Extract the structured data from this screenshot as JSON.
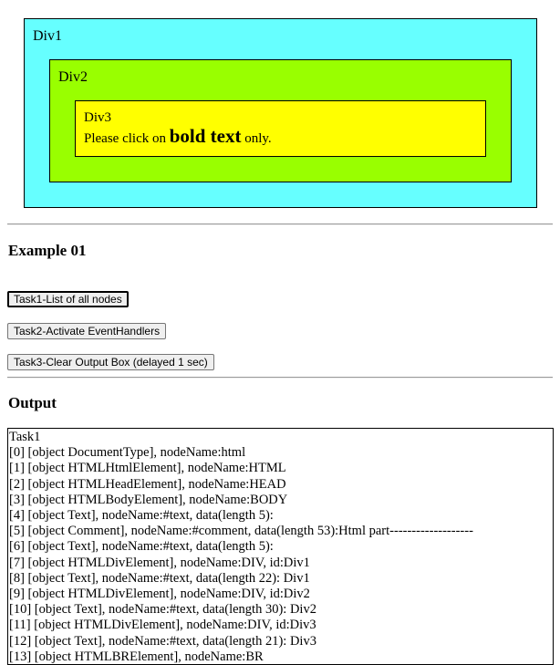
{
  "div1": {
    "label": "Div1"
  },
  "div2": {
    "label": "Div2"
  },
  "div3": {
    "label": "Div3",
    "text_before": "Please click on ",
    "bold_text": "bold text",
    "text_after": " only."
  },
  "example": {
    "heading": "Example 01"
  },
  "buttons": {
    "task1": "Task1-List of all nodes",
    "task2": "Task2-Activate EventHandlers",
    "task3": "Task3-Clear Output Box (delayed 1 sec)"
  },
  "output": {
    "heading": "Output",
    "lines": [
      "Task1",
      "[0] [object DocumentType], nodeName:html",
      "[1] [object HTMLHtmlElement], nodeName:HTML",
      "[2] [object HTMLHeadElement], nodeName:HEAD",
      "[3] [object HTMLBodyElement], nodeName:BODY",
      "[4] [object Text], nodeName:#text, data(length 5):",
      "[5] [object Comment], nodeName:#comment, data(length 53):Html part-------------------",
      "[6] [object Text], nodeName:#text, data(length 5):",
      "[7] [object HTMLDivElement], nodeName:DIV, id:Div1",
      "[8] [object Text], nodeName:#text, data(length 22): Div1",
      "[9] [object HTMLDivElement], nodeName:DIV, id:Div2",
      "[10] [object Text], nodeName:#text, data(length 30): Div2",
      "[11] [object HTMLDivElement], nodeName:DIV, id:Div3",
      "[12] [object Text], nodeName:#text, data(length 21): Div3",
      "[13] [object HTMLBRElement], nodeName:BR"
    ]
  }
}
